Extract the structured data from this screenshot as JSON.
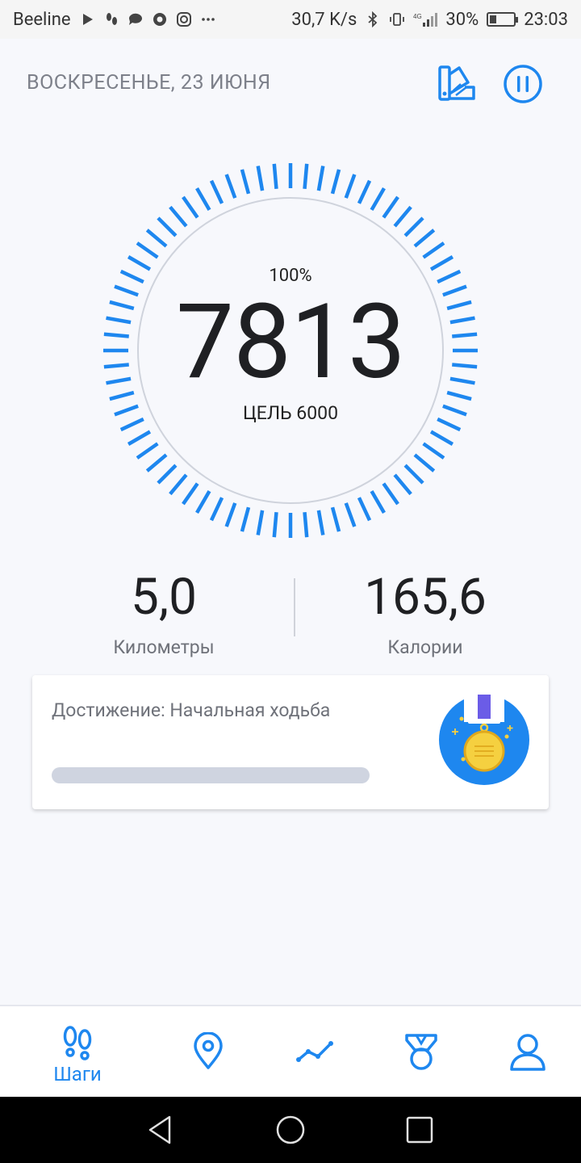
{
  "status_bar": {
    "carrier": "Beeline",
    "speed": "30,7 K/s",
    "network": "4G",
    "battery": "30%",
    "battery_level": 0.3,
    "time": "23:03"
  },
  "header": {
    "date": "ВОСКРЕСЕНЬЕ, 23 ИЮНЯ"
  },
  "progress_ring": {
    "percent_label": "100%",
    "steps": "7813",
    "goal_label": "ЦЕЛЬ 6000",
    "completion": 1.0
  },
  "stats": {
    "distance_value": "5,0",
    "distance_label": "Километры",
    "calories_value": "165,6",
    "calories_label": "Калории"
  },
  "achievement": {
    "title": "Достижение: Начальная ходьба",
    "progress": 0
  },
  "bottom_nav": {
    "steps_label": "Шаги"
  },
  "colors": {
    "accent": "#1e87ef",
    "ring_track": "#cfd3dc",
    "background": "#f7f8fc",
    "text_muted": "#7d808a",
    "medal_bg": "#1e87ef",
    "medal_gold": "#f5d040",
    "ribbon": "#6b5ce7"
  },
  "icons": {
    "theme_button": "palette-icon",
    "pause_button": "pause-icon",
    "nav": [
      "footprints-icon",
      "location-pin-icon",
      "trend-line-icon",
      "medal-icon",
      "person-icon"
    ]
  }
}
